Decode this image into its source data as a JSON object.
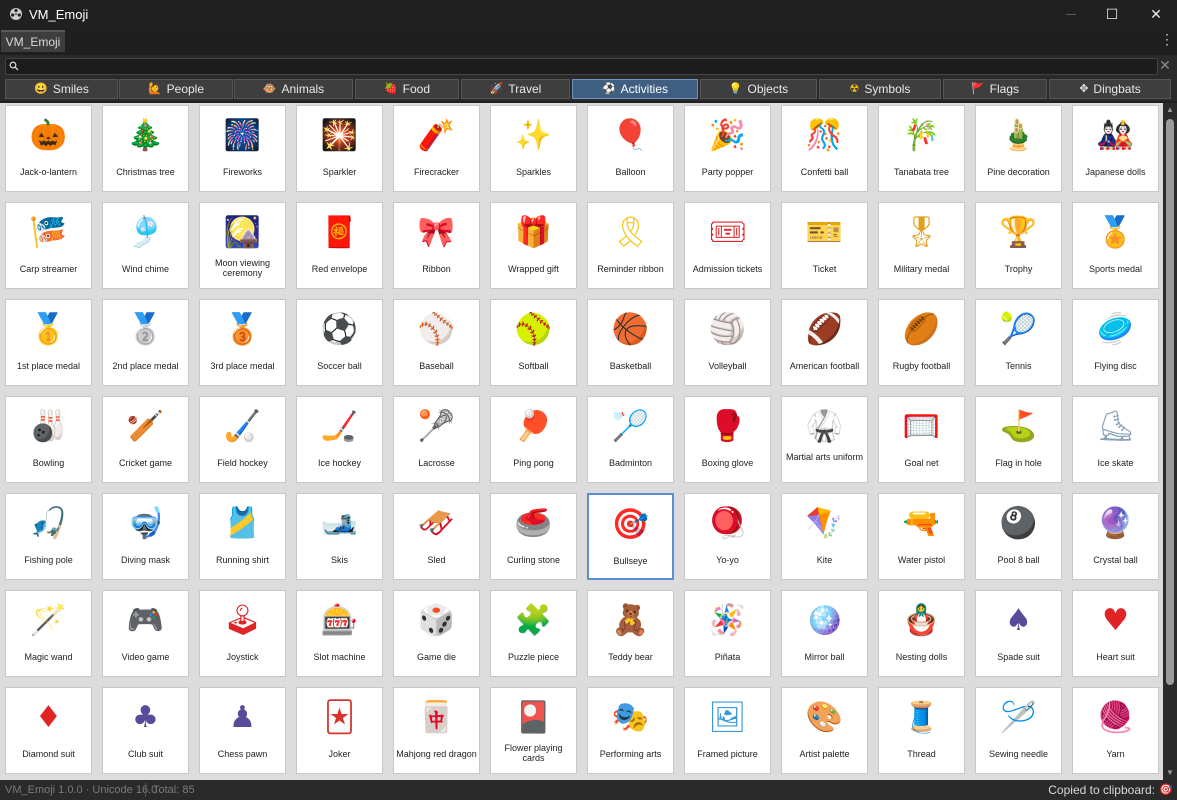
{
  "window": {
    "title": "VM_Emoji",
    "minimize": "—",
    "maximize": "☐",
    "close": "✕",
    "app_icon": "film-reel-icon"
  },
  "doc_tab": {
    "label": "VM_Emoji"
  },
  "menu": {
    "kebab": "⋮"
  },
  "search": {
    "placeholder": "",
    "value": "",
    "clear": "✕"
  },
  "categories": [
    {
      "label": "Smiles",
      "icon": "😀",
      "color": "#f5b400"
    },
    {
      "label": "People",
      "icon": "🙋",
      "color": "#f5a623"
    },
    {
      "label": "Animals",
      "icon": "🐵",
      "color": "#c98a3a"
    },
    {
      "label": "Food",
      "icon": "🍓",
      "color": "#e0334a"
    },
    {
      "label": "Travel",
      "icon": "🚀",
      "color": "#7aa7d8"
    },
    {
      "label": "Activities",
      "icon": "⚽",
      "color": "#e6e6e6"
    },
    {
      "label": "Objects",
      "icon": "💡",
      "color": "#f5c518"
    },
    {
      "label": "Symbols",
      "icon": "☢",
      "color": "#f5c518"
    },
    {
      "label": "Flags",
      "icon": "🚩",
      "color": "#e03a3a"
    },
    {
      "label": "Dingbats",
      "icon": "✥",
      "color": "#e6e6e6"
    }
  ],
  "active_category": "Activities",
  "emojis": [
    {
      "label": "Jack-o-lantern",
      "glyph": "🎃",
      "color": "#f28c28"
    },
    {
      "label": "Christmas tree",
      "glyph": "🎄",
      "color": "#3c9a3c"
    },
    {
      "label": "Fireworks",
      "glyph": "🎆",
      "color": "#5b2e8c"
    },
    {
      "label": "Sparkler",
      "glyph": "🎇",
      "color": "#5b2e8c"
    },
    {
      "label": "Firecracker",
      "glyph": "🧨",
      "color": "#d9342b"
    },
    {
      "label": "Sparkles",
      "glyph": "✨",
      "color": "#f5c518"
    },
    {
      "label": "Balloon",
      "glyph": "🎈",
      "color": "#e0334a"
    },
    {
      "label": "Party popper",
      "glyph": "🎉",
      "color": "#e89c2a"
    },
    {
      "label": "Confetti ball",
      "glyph": "🎊",
      "color": "#e89c2a"
    },
    {
      "label": "Tanabata tree",
      "glyph": "🎋",
      "color": "#3c9a3c"
    },
    {
      "label": "Pine decoration",
      "glyph": "🎍",
      "color": "#3c9a3c"
    },
    {
      "label": "Japanese dolls",
      "glyph": "🎎",
      "color": "#d9342b"
    },
    {
      "label": "Carp streamer",
      "glyph": "🎏",
      "color": "#d9342b"
    },
    {
      "label": "Wind chime",
      "glyph": "🎐",
      "color": "#7ab8e0"
    },
    {
      "label": "Moon viewing ceremony",
      "glyph": "🎑",
      "color": "#4a2e1e"
    },
    {
      "label": "Red envelope",
      "glyph": "🧧",
      "color": "#e02424"
    },
    {
      "label": "Ribbon",
      "glyph": "🎀",
      "color": "#d9342b"
    },
    {
      "label": "Wrapped gift",
      "glyph": "🎁",
      "color": "#f5b400"
    },
    {
      "label": "Reminder ribbon",
      "glyph": "🎗",
      "color": "#f5c518"
    },
    {
      "label": "Admission tickets",
      "glyph": "🎟",
      "color": "#e02424"
    },
    {
      "label": "Ticket",
      "glyph": "🎫",
      "color": "#f5b400"
    },
    {
      "label": "Military medal",
      "glyph": "🎖",
      "color": "#e0a020"
    },
    {
      "label": "Trophy",
      "glyph": "🏆",
      "color": "#e0a020"
    },
    {
      "label": "Sports medal",
      "glyph": "🏅",
      "color": "#e0a020"
    },
    {
      "label": "1st place medal",
      "glyph": "🥇",
      "color": "#e0a020"
    },
    {
      "label": "2nd place medal",
      "glyph": "🥈",
      "color": "#9a9a9a"
    },
    {
      "label": "3rd place medal",
      "glyph": "🥉",
      "color": "#c0702a"
    },
    {
      "label": "Soccer ball",
      "glyph": "⚽",
      "color": "#2a4ab0"
    },
    {
      "label": "Baseball",
      "glyph": "⚾",
      "color": "#c0392b"
    },
    {
      "label": "Softball",
      "glyph": "🥎",
      "color": "#a8c83a"
    },
    {
      "label": "Basketball",
      "glyph": "🏀",
      "color": "#e0661a"
    },
    {
      "label": "Volleyball",
      "glyph": "🏐",
      "color": "#8a8a8a"
    },
    {
      "label": "American football",
      "glyph": "🏈",
      "color": "#7a3a1e"
    },
    {
      "label": "Rugby football",
      "glyph": "🏉",
      "color": "#f08a1a"
    },
    {
      "label": "Tennis",
      "glyph": "🎾",
      "color": "#d9342b"
    },
    {
      "label": "Flying disc",
      "glyph": "🥏",
      "color": "#2aa0d8"
    },
    {
      "label": "Bowling",
      "glyph": "🎳",
      "color": "#5a4a8a"
    },
    {
      "label": "Cricket game",
      "glyph": "🏏",
      "color": "#e0902a"
    },
    {
      "label": "Field hockey",
      "glyph": "🏑",
      "color": "#c06a5a"
    },
    {
      "label": "Ice hockey",
      "glyph": "🏒",
      "color": "#d9342b"
    },
    {
      "label": "Lacrosse",
      "glyph": "🥍",
      "color": "#2a7ad8"
    },
    {
      "label": "Ping pong",
      "glyph": "🏓",
      "color": "#e0334a"
    },
    {
      "label": "Badminton",
      "glyph": "🏸",
      "color": "#2a7ad8"
    },
    {
      "label": "Boxing glove",
      "glyph": "🥊",
      "color": "#e02424"
    },
    {
      "label": "Martial arts uniform",
      "glyph": "🥋",
      "color": "#7a7a9a"
    },
    {
      "label": "Goal net",
      "glyph": "🥅",
      "color": "#d9342b"
    },
    {
      "label": "Flag in hole",
      "glyph": "⛳",
      "color": "#3c9a3c"
    },
    {
      "label": "Ice skate",
      "glyph": "⛸",
      "color": "#8aa0b8"
    },
    {
      "label": "Fishing pole",
      "glyph": "🎣",
      "color": "#5aa0c8"
    },
    {
      "label": "Diving mask",
      "glyph": "🤿",
      "color": "#e02424"
    },
    {
      "label": "Running shirt",
      "glyph": "🎽",
      "color": "#6aa02a"
    },
    {
      "label": "Skis",
      "glyph": "🎿",
      "color": "#2a9ad8"
    },
    {
      "label": "Sled",
      "glyph": "🛷",
      "color": "#c0702a"
    },
    {
      "label": "Curling stone",
      "glyph": "🥌",
      "color": "#c0392b"
    },
    {
      "label": "Bullseye",
      "glyph": "🎯",
      "color": "#e02424"
    },
    {
      "label": "Yo-yo",
      "glyph": "🪀",
      "color": "#7a4ab0"
    },
    {
      "label": "Kite",
      "glyph": "🪁",
      "color": "#2a9ad8"
    },
    {
      "label": "Water pistol",
      "glyph": "🔫",
      "color": "#6ac83a"
    },
    {
      "label": "Pool 8 ball",
      "glyph": "🎱",
      "color": "#2a2a3a"
    },
    {
      "label": "Crystal ball",
      "glyph": "🔮",
      "color": "#5a3a9a"
    },
    {
      "label": "Magic wand",
      "glyph": "🪄",
      "color": "#3a3a3a"
    },
    {
      "label": "Video game",
      "glyph": "🎮",
      "color": "#4a3a7a"
    },
    {
      "label": "Joystick",
      "glyph": "🕹",
      "color": "#e02424"
    },
    {
      "label": "Slot machine",
      "glyph": "🎰",
      "color": "#7a7a8a"
    },
    {
      "label": "Game die",
      "glyph": "🎲",
      "color": "#8a8a9a"
    },
    {
      "label": "Puzzle piece",
      "glyph": "🧩",
      "color": "#8ad83a"
    },
    {
      "label": "Teddy bear",
      "glyph": "🧸",
      "color": "#c0702a"
    },
    {
      "label": "Piñata",
      "glyph": "🪅",
      "color": "#2a9ad8"
    },
    {
      "label": "Mirror ball",
      "glyph": "🪩",
      "color": "#9a9a9a"
    },
    {
      "label": "Nesting dolls",
      "glyph": "🪆",
      "color": "#e0334a"
    },
    {
      "label": "Spade suit",
      "glyph": "♠",
      "color": "#5a4a9a"
    },
    {
      "label": "Heart suit",
      "glyph": "♥",
      "color": "#e02424"
    },
    {
      "label": "Diamond suit",
      "glyph": "♦",
      "color": "#e02424"
    },
    {
      "label": "Club suit",
      "glyph": "♣",
      "color": "#5a4a9a"
    },
    {
      "label": "Chess pawn",
      "glyph": "♟",
      "color": "#5a4a9a"
    },
    {
      "label": "Joker",
      "glyph": "🃏",
      "color": "#d9342b"
    },
    {
      "label": "Mahjong red dragon",
      "glyph": "🀄",
      "color": "#d9342b"
    },
    {
      "label": "Flower playing cards",
      "glyph": "🎴",
      "color": "#e0347a"
    },
    {
      "label": "Performing arts",
      "glyph": "🎭",
      "color": "#e0a020"
    },
    {
      "label": "Framed picture",
      "glyph": "🖼",
      "color": "#3c9ad8"
    },
    {
      "label": "Artist palette",
      "glyph": "🎨",
      "color": "#d8a070"
    },
    {
      "label": "Thread",
      "glyph": "🧵",
      "color": "#2a6ab0"
    },
    {
      "label": "Sewing needle",
      "glyph": "🪡",
      "color": "#6a8ab0"
    },
    {
      "label": "Yarn",
      "glyph": "🧶",
      "color": "#2a9ad8"
    }
  ],
  "selected_emoji": "Bullseye",
  "status": {
    "version": "VM_Emoji 1.0.0 · Unicode 16.0",
    "total": "Total: 85",
    "copied": "Copied to clipboard:",
    "copied_glyph": "🎯"
  }
}
